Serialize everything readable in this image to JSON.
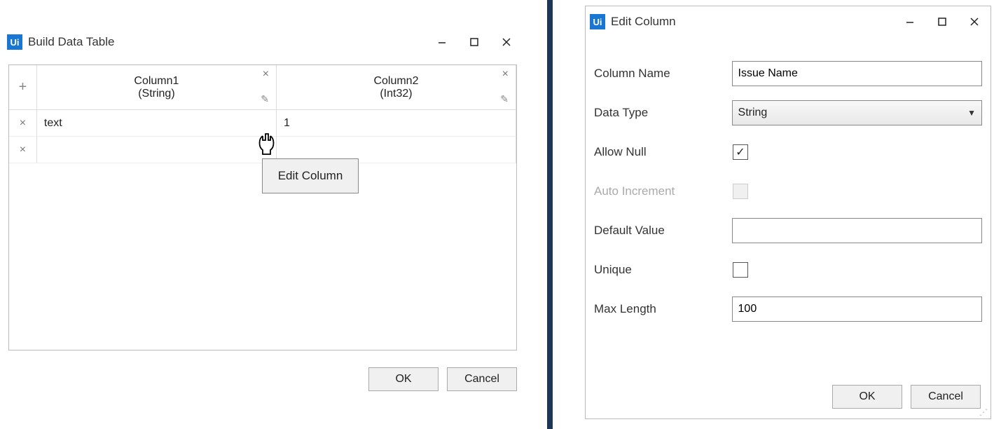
{
  "left": {
    "title": "Build Data Table",
    "columns": [
      {
        "name": "Column1",
        "type": "(String)"
      },
      {
        "name": "Column2",
        "type": "(Int32)"
      }
    ],
    "rows": [
      {
        "c0": "text",
        "c1": "1"
      },
      {
        "c0": "",
        "c1": ""
      }
    ],
    "tooltip": "Edit Column",
    "ok": "OK",
    "cancel": "Cancel"
  },
  "right": {
    "title": "Edit Column",
    "labels": {
      "column_name": "Column Name",
      "data_type": "Data Type",
      "allow_null": "Allow Null",
      "auto_increment": "Auto Increment",
      "default_value": "Default Value",
      "unique": "Unique",
      "max_length": "Max Length"
    },
    "values": {
      "column_name": "Issue Name",
      "data_type": "String",
      "allow_null": true,
      "auto_increment": false,
      "default_value": "",
      "unique": false,
      "max_length": "100"
    },
    "ok": "OK",
    "cancel": "Cancel"
  }
}
